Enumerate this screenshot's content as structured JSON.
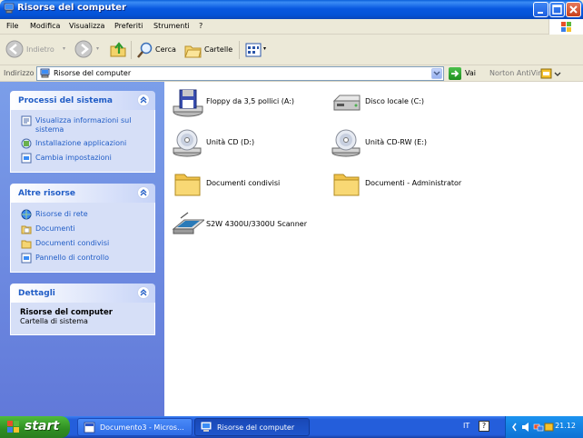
{
  "window": {
    "title": "Risorse del computer"
  },
  "menubar": {
    "items": [
      "File",
      "Modifica",
      "Visualizza",
      "Preferiti",
      "Strumenti",
      "?"
    ]
  },
  "toolbar": {
    "back_label": "Indietro",
    "search_label": "Cerca",
    "folders_label": "Cartelle"
  },
  "addressbar": {
    "label": "Indirizzo",
    "value": "Risorse del computer",
    "go_label": "Vai",
    "norton_label": "Norton AntiVirus"
  },
  "leftpane": {
    "system_tasks": {
      "title": "Processi del sistema",
      "links": [
        {
          "label": "Visualizza informazioni sul sistema",
          "icon": "system-info-icon"
        },
        {
          "label": "Installazione applicazioni",
          "icon": "add-remove-programs-icon"
        },
        {
          "label": "Cambia impostazioni",
          "icon": "control-panel-icon"
        }
      ]
    },
    "other_places": {
      "title": "Altre risorse",
      "links": [
        {
          "label": "Risorse di rete",
          "icon": "network-icon"
        },
        {
          "label": "Documenti",
          "icon": "documents-folder-icon"
        },
        {
          "label": "Documenti condivisi",
          "icon": "shared-folder-icon"
        },
        {
          "label": "Pannello di controllo",
          "icon": "control-panel-icon"
        }
      ]
    },
    "details": {
      "title": "Dettagli",
      "name": "Risorse del computer",
      "description": "Cartella di sistema"
    }
  },
  "content": {
    "items": [
      {
        "label": "Floppy da 3,5 pollici (A:)",
        "icon": "floppy-drive-icon"
      },
      {
        "label": "Disco locale (C:)",
        "icon": "hard-disk-icon"
      },
      {
        "label": "Unità CD (D:)",
        "icon": "cd-drive-icon"
      },
      {
        "label": "Unità CD-RW (E:)",
        "icon": "cd-drive-icon"
      },
      {
        "label": "Documenti condivisi",
        "icon": "folder-icon"
      },
      {
        "label": "Documenti - Administrator",
        "icon": "folder-icon"
      },
      {
        "label": "S2W 4300U/3300U Scanner",
        "icon": "scanner-icon"
      }
    ]
  },
  "taskbar": {
    "start_label": "start",
    "tasks": [
      {
        "label": "Documento3 - Micros...",
        "icon": "word-document-icon"
      },
      {
        "label": "Risorse del computer",
        "icon": "my-computer-icon"
      }
    ],
    "language": "IT",
    "time": "21.12"
  },
  "colors": {
    "titlebar": "#0858e0",
    "taskpane_bg": "#6f8ee3",
    "link": "#215dc6",
    "start_green": "#3a9a2a"
  }
}
